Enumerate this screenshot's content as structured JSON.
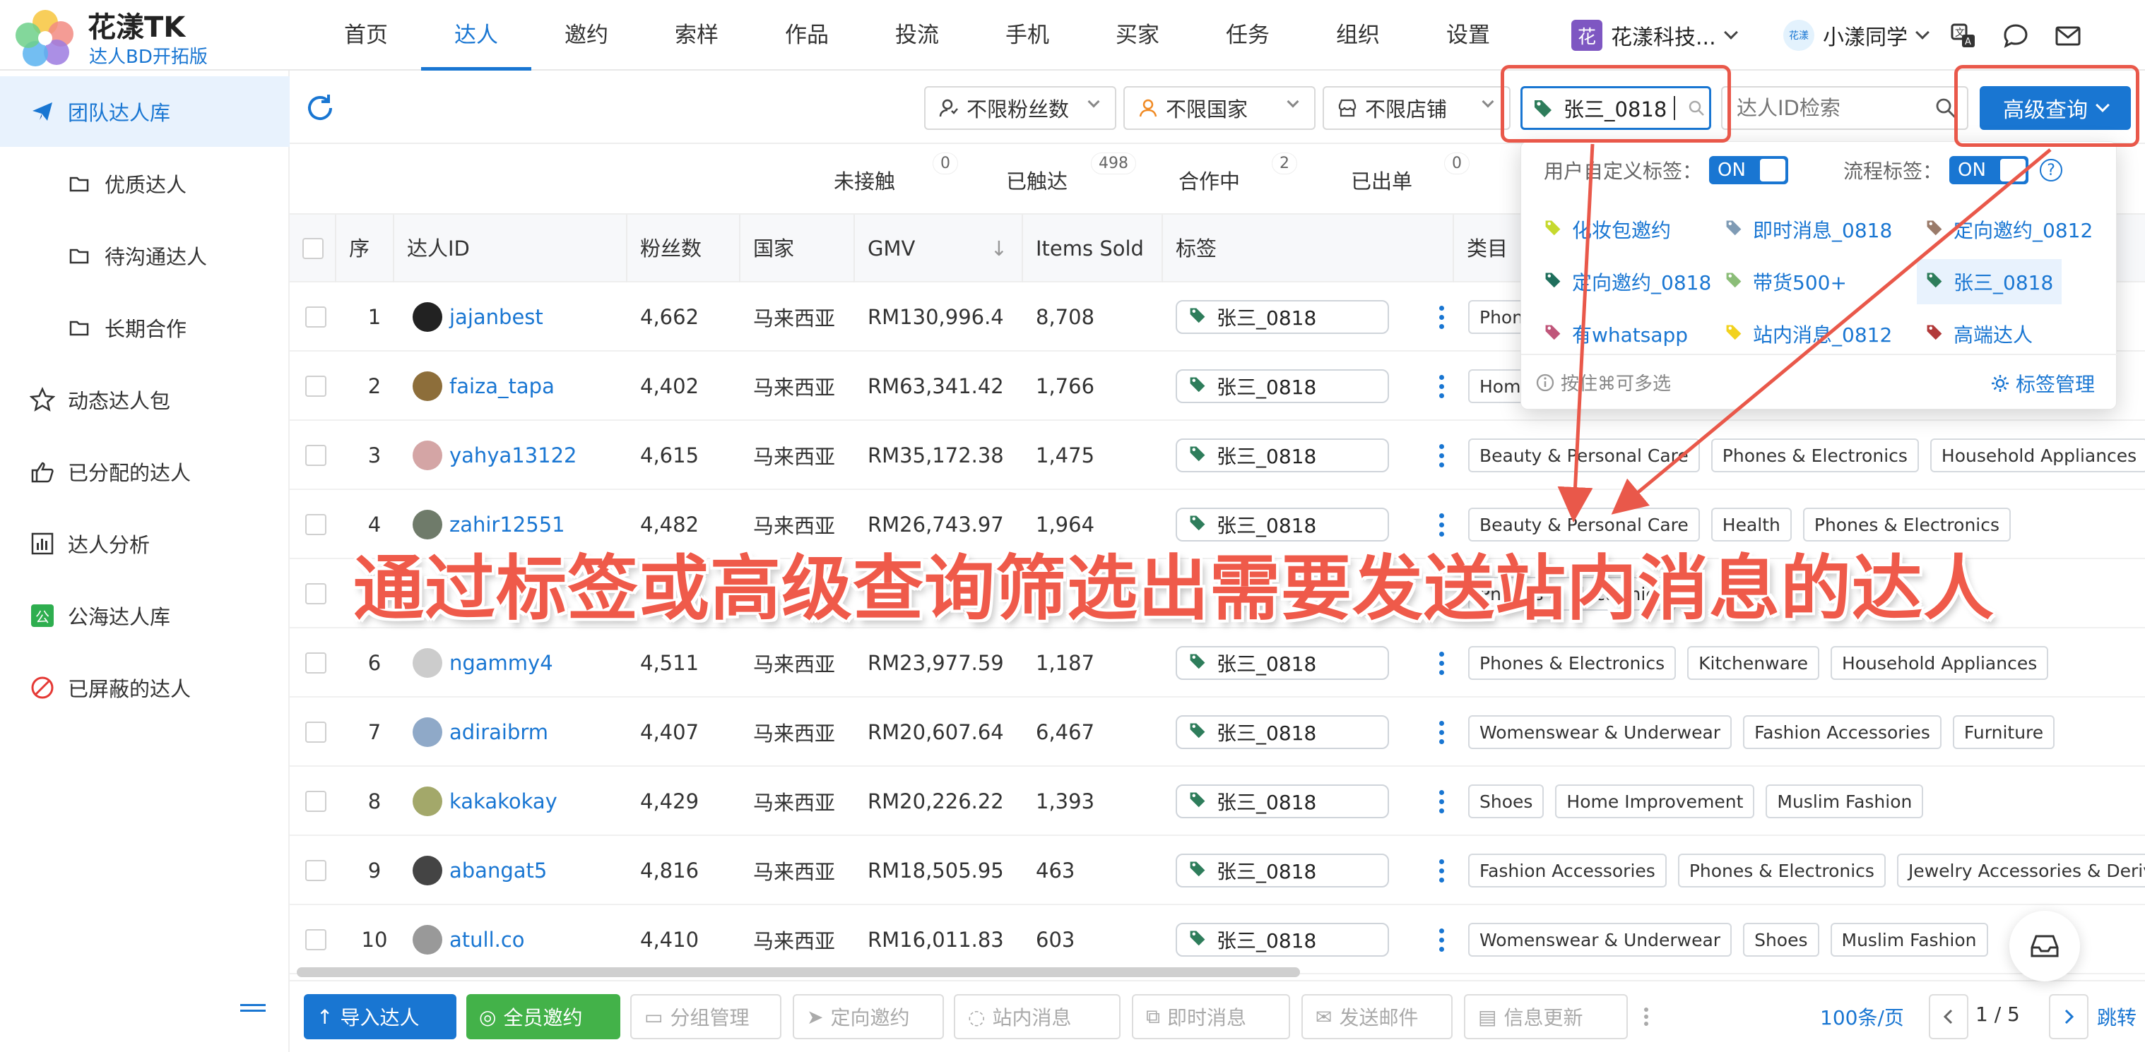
{
  "app": {
    "title": "花漾TK",
    "subtitle": "达人BD开拓版"
  },
  "nav": {
    "items": [
      "首页",
      "达人",
      "邀约",
      "索样",
      "作品",
      "投流",
      "手机",
      "买家",
      "任务",
      "组织",
      "设置"
    ],
    "active_index": 1
  },
  "header": {
    "org_badge": "花",
    "org_name": "花漾科技...",
    "user_name": "小漾同学",
    "user_avatar_text": "花漾"
  },
  "sidebar": {
    "items": [
      {
        "label": "团队达人库",
        "icon": "paper-plane-icon",
        "active": true
      },
      {
        "label": "优质达人",
        "icon": "folder-icon"
      },
      {
        "label": "待沟通达人",
        "icon": "folder-icon"
      },
      {
        "label": "长期合作",
        "icon": "folder-icon"
      },
      {
        "label": "动态达人包",
        "icon": "star-icon"
      },
      {
        "label": "已分配的达人",
        "icon": "hand-point-icon"
      },
      {
        "label": "达人分析",
        "icon": "bar-chart-icon"
      },
      {
        "label": "公海达人库",
        "icon": "public-badge-icon",
        "badge": "公"
      },
      {
        "label": "已屏蔽的达人",
        "icon": "block-icon"
      }
    ]
  },
  "toolbar": {
    "filter_fans": "不限粉丝数",
    "filter_country": "不限国家",
    "filter_shop": "不限店铺",
    "tag_value": "张三_0818",
    "id_placeholder": "达人ID检索",
    "advanced_query": "高级查询"
  },
  "status_tabs": [
    {
      "label": "未接触",
      "count": "0"
    },
    {
      "label": "已触达",
      "count": "498"
    },
    {
      "label": "合作中",
      "count": "2"
    },
    {
      "label": "已出单",
      "count": "0"
    }
  ],
  "table": {
    "columns": [
      "序",
      "达人ID",
      "粉丝数",
      "国家",
      "GMV",
      "Items Sold",
      "标签",
      "类目"
    ],
    "rows": [
      {
        "idx": "1",
        "id": "jajanbest",
        "fans": "4,662",
        "country": "马来西亚",
        "gmv": "RM130,996.4",
        "sold": "8,708",
        "tag": "张三_0818",
        "cats": [
          "Phones & Electronics"
        ]
      },
      {
        "idx": "2",
        "id": "faiza_tapa",
        "fans": "4,402",
        "country": "马来西亚",
        "gmv": "RM63,341.42",
        "sold": "1,766",
        "tag": "张三_0818",
        "cats": [
          "Home Supplies"
        ]
      },
      {
        "idx": "3",
        "id": "yahya13122",
        "fans": "4,615",
        "country": "马来西亚",
        "gmv": "RM35,172.38",
        "sold": "1,475",
        "tag": "张三_0818",
        "cats": [
          "Beauty & Personal Care",
          "Phones & Electronics",
          "Household Appliances"
        ]
      },
      {
        "idx": "4",
        "id": "zahir12551",
        "fans": "4,482",
        "country": "马来西亚",
        "gmv": "RM26,743.97",
        "sold": "1,964",
        "tag": "张三_0818",
        "cats": [
          "Beauty & Personal Care",
          "Health",
          "Phones & Electronics"
        ]
      },
      {
        "idx": "5",
        "id": "",
        "fans": "",
        "country": "",
        "gmv": "",
        "sold": "",
        "tag": "",
        "cats": [
          "Phones & Electronics"
        ]
      },
      {
        "idx": "6",
        "id": "ngammy4",
        "fans": "4,511",
        "country": "马来西亚",
        "gmv": "RM23,977.59",
        "sold": "1,187",
        "tag": "张三_0818",
        "cats": [
          "Phones & Electronics",
          "Kitchenware",
          "Household Appliances"
        ]
      },
      {
        "idx": "7",
        "id": "adiraibrm",
        "fans": "4,407",
        "country": "马来西亚",
        "gmv": "RM20,607.64",
        "sold": "6,467",
        "tag": "张三_0818",
        "cats": [
          "Womenswear & Underwear",
          "Fashion Accessories",
          "Furniture"
        ]
      },
      {
        "idx": "8",
        "id": "kakakokay",
        "fans": "4,429",
        "country": "马来西亚",
        "gmv": "RM20,226.22",
        "sold": "1,393",
        "tag": "张三_0818",
        "cats": [
          "Shoes",
          "Home Improvement",
          "Muslim Fashion"
        ]
      },
      {
        "idx": "9",
        "id": "abangat5",
        "fans": "4,816",
        "country": "马来西亚",
        "gmv": "RM18,505.95",
        "sold": "463",
        "tag": "张三_0818",
        "cats": [
          "Fashion Accessories",
          "Phones & Electronics",
          "Jewelry Accessories & Derivatives"
        ]
      },
      {
        "idx": "10",
        "id": "atull.co",
        "fans": "4,410",
        "country": "马来西亚",
        "gmv": "RM16,011.83",
        "sold": "603",
        "tag": "张三_0818",
        "cats": [
          "Womenswear & Underwear",
          "Shoes",
          "Muslim Fashion"
        ]
      }
    ]
  },
  "dropdown": {
    "custom_label": "用户自定义标签：",
    "flow_label": "流程标签：",
    "toggle_on": "ON",
    "options": [
      {
        "label": "化妆包邀约",
        "color": "#c6d92e"
      },
      {
        "label": "即时消息_0818",
        "color": "#7f9bb5"
      },
      {
        "label": "定向邀约_0812",
        "color": "#9a7b6a"
      },
      {
        "label": "定向邀约_0818",
        "color": "#1f6f5c"
      },
      {
        "label": "带货500+",
        "color": "#8bbd78"
      },
      {
        "label": "张三_0818",
        "color": "#2e7d5b",
        "selected": true
      },
      {
        "label": "有whatsapp",
        "color": "#c0567a"
      },
      {
        "label": "站内消息_0812",
        "color": "#f2d21e"
      },
      {
        "label": "高端达人",
        "color": "#b23a3a"
      }
    ],
    "hint": "按住⌘可多选",
    "manage": "标签管理"
  },
  "annotation": {
    "text": "通过标签或高级查询筛选出需要发送站内消息的达人"
  },
  "bottom": {
    "buttons": [
      "导入达人",
      "全员邀约",
      "分组管理",
      "定向邀约",
      "站内消息",
      "即时消息",
      "发送邮件",
      "信息更新"
    ],
    "page_size": "100条/页",
    "page": "1 / 5",
    "jump": "跳转"
  },
  "colors": {
    "primary": "#1976d2",
    "annotation": "#ef5a4a",
    "green": "#43b249"
  }
}
